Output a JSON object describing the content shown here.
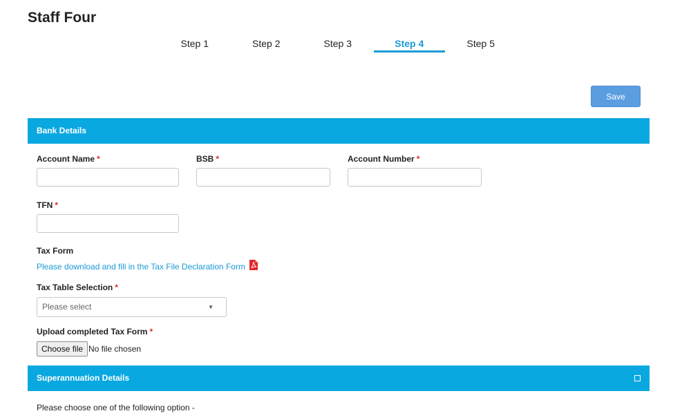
{
  "page": {
    "title": "Staff Four"
  },
  "steps": [
    {
      "label": "Step 1"
    },
    {
      "label": "Step 2"
    },
    {
      "label": "Step 3"
    },
    {
      "label": "Step 4",
      "active": true
    },
    {
      "label": "Step 5"
    }
  ],
  "toolbar": {
    "save_label": "Save"
  },
  "bank": {
    "header": "Bank Details",
    "account_name": {
      "label": "Account Name",
      "value": ""
    },
    "bsb": {
      "label": "BSB",
      "value": ""
    },
    "account_number": {
      "label": "Account Number",
      "value": ""
    },
    "tfn": {
      "label": "TFN",
      "value": ""
    },
    "tax_form": {
      "label": "Tax Form",
      "link_text": "Please download and fill in the Tax File Declaration Form",
      "icon": "pdf-icon"
    },
    "tax_table": {
      "label": "Tax Table Selection",
      "placeholder": "Please select"
    },
    "upload": {
      "label": "Upload completed Tax Form",
      "button": "Choose file",
      "status": "No file chosen"
    }
  },
  "super": {
    "header": "Superannuation Details",
    "intro": "Please choose one of the following option -"
  },
  "required_mark": "*",
  "colors": {
    "accent": "#0aa8e0",
    "active_step": "#1a9ad6",
    "save_button": "#5b9ee0",
    "required": "#e3262b"
  }
}
